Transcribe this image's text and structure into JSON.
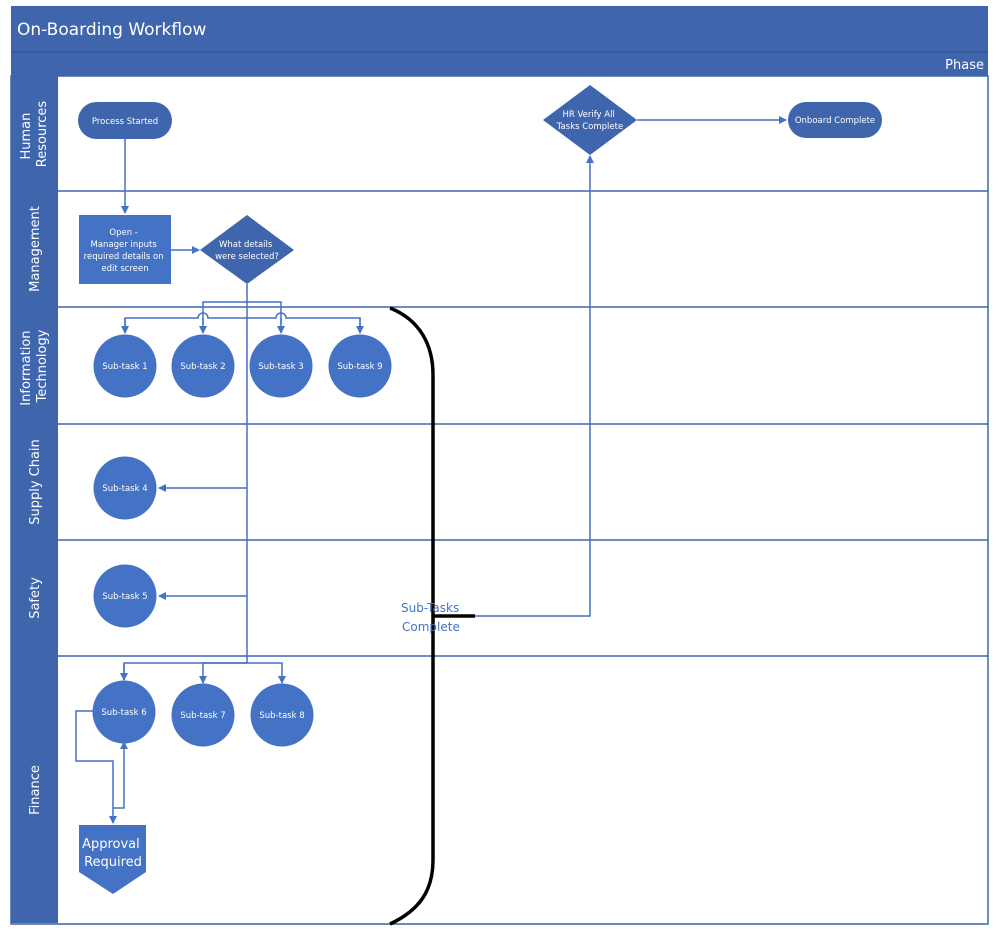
{
  "diagram": {
    "title": "On-Boarding Workflow",
    "phase_label": "Phase",
    "colors": {
      "header": "#3f65ad",
      "header_border": "#2f4f8a",
      "node_fill": "#4472c4",
      "decision_fill": "#3f65ad",
      "connector": "#4472c4",
      "brace": "#000000",
      "annotation": "#4472c4"
    },
    "lanes": [
      {
        "id": "hr",
        "label_lines": [
          "Human",
          "Resources"
        ]
      },
      {
        "id": "mgmt",
        "label_lines": [
          "Management"
        ]
      },
      {
        "id": "it",
        "label_lines": [
          "Information",
          "Technology"
        ]
      },
      {
        "id": "supply",
        "label_lines": [
          "Supply Chain"
        ]
      },
      {
        "id": "safety",
        "label_lines": [
          "Safety"
        ]
      },
      {
        "id": "finance",
        "label_lines": [
          "Finance"
        ]
      }
    ],
    "nodes": {
      "process_started": {
        "type": "terminator",
        "lines": [
          "Process Started"
        ]
      },
      "hr_verify": {
        "type": "decision",
        "lines": [
          "HR Verify All",
          "Tasks Complete"
        ]
      },
      "onboard_complete": {
        "type": "terminator",
        "lines": [
          "Onboard Complete"
        ]
      },
      "manager_inputs": {
        "type": "process",
        "lines": [
          "Open -",
          "Manager inputs",
          "required details on",
          "edit screen"
        ]
      },
      "what_details": {
        "type": "decision",
        "lines": [
          "What details",
          "were selected?"
        ]
      },
      "subtask_1": {
        "type": "circle",
        "lines": [
          "Sub-task 1"
        ]
      },
      "subtask_2": {
        "type": "circle",
        "lines": [
          "Sub-task 2"
        ]
      },
      "subtask_3": {
        "type": "circle",
        "lines": [
          "Sub-task 3"
        ]
      },
      "subtask_9": {
        "type": "circle",
        "lines": [
          "Sub-task 9"
        ]
      },
      "subtask_4": {
        "type": "circle",
        "lines": [
          "Sub-task 4"
        ]
      },
      "subtask_5": {
        "type": "circle",
        "lines": [
          "Sub-task 5"
        ]
      },
      "subtask_6": {
        "type": "circle",
        "lines": [
          "Sub-task 6"
        ]
      },
      "subtask_7": {
        "type": "circle",
        "lines": [
          "Sub-task 7"
        ]
      },
      "subtask_8": {
        "type": "circle",
        "lines": [
          "Sub-task 8"
        ]
      },
      "approval_required": {
        "type": "off-page-reference",
        "lines": [
          "Approval",
          "Required"
        ]
      }
    },
    "annotation": {
      "lines": [
        "Sub-Tasks",
        "Complete"
      ]
    }
  }
}
